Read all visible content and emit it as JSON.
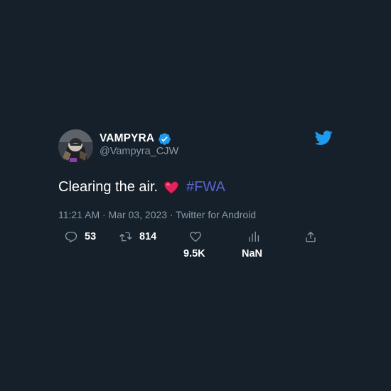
{
  "tweet": {
    "display_name": "VAMPYRA",
    "handle": "@Vampyra_CJW",
    "verified": true,
    "text": "Clearing the air.",
    "emoji": "heart-emoji",
    "hashtag": "#FWA",
    "timestamp": "11:21 AM · Mar 03, 2023 · Twitter for Android"
  },
  "actions": {
    "reply_count": "53",
    "retweet_count": "814",
    "like_count": "9.5K",
    "views_count": "NaN"
  },
  "icons": {
    "brand": "twitter-bird-icon",
    "reply": "reply-icon",
    "retweet": "retweet-icon",
    "like": "heart-outline-icon",
    "views": "views-icon",
    "share": "share-icon",
    "verified": "verified-badge-icon"
  },
  "colors": {
    "background": "#15202b",
    "text_primary": "#ffffff",
    "text_secondary": "#8b98a5",
    "accent": "#1d9bf0",
    "hashtag": "#5b63c9",
    "heart_emoji": "#e0245e"
  }
}
